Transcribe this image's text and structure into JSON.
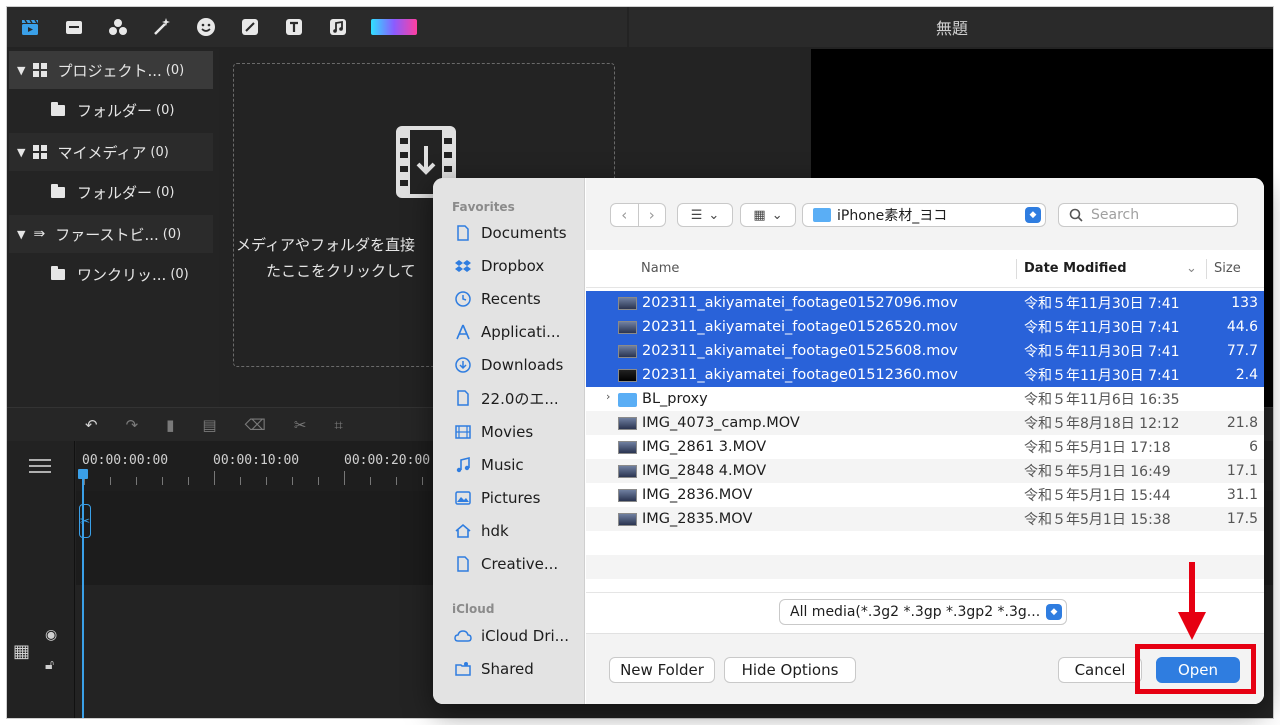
{
  "app": {
    "window_title": "無題",
    "toolbar_icons": [
      "clapper-icon",
      "media-icon",
      "effects-icon",
      "magic-icon",
      "sticker-icon",
      "transition-icon",
      "text-icon",
      "music-icon",
      "color-icon"
    ]
  },
  "library": {
    "items": [
      {
        "label": "プロジェクト...",
        "count": "(0)",
        "level": "parent",
        "icon": "grid-icon"
      },
      {
        "label": "フォルダー",
        "count": "(0)",
        "level": "sub",
        "icon": "folder-icon"
      },
      {
        "label": "マイメディア",
        "count": "(0)",
        "level": "parent",
        "icon": "grid-icon"
      },
      {
        "label": "フォルダー",
        "count": "(0)",
        "level": "sub",
        "icon": "folder-icon"
      },
      {
        "label": "ファーストビ...",
        "count": "(0)",
        "level": "parent",
        "icon": "arrow-icon"
      },
      {
        "label": "ワンクリッ...",
        "count": "(0)",
        "level": "sub",
        "icon": "folder-icon"
      }
    ]
  },
  "media": {
    "drop_line1": "メディアやフォルダを直接",
    "drop_line2": "たここをクリックして"
  },
  "timeline": {
    "timecodes": [
      "00:00:00:00",
      "00:00:10:00",
      "00:00:20:00"
    ]
  },
  "dialog": {
    "sidebar": {
      "favorites_label": "Favorites",
      "favorites": [
        {
          "label": "Documents",
          "icon": "document-icon"
        },
        {
          "label": "Dropbox",
          "icon": "dropbox-icon"
        },
        {
          "label": "Recents",
          "icon": "clock-icon"
        },
        {
          "label": "Applicati...",
          "icon": "applications-icon"
        },
        {
          "label": "Downloads",
          "icon": "download-icon"
        },
        {
          "label": "22.0のエ...",
          "icon": "document-icon"
        },
        {
          "label": "Movies",
          "icon": "film-icon"
        },
        {
          "label": "Music",
          "icon": "music-note-icon"
        },
        {
          "label": "Pictures",
          "icon": "picture-icon"
        },
        {
          "label": "hdk",
          "icon": "home-icon"
        },
        {
          "label": "Creative...",
          "icon": "document-icon"
        }
      ],
      "icloud_label": "iCloud",
      "icloud": [
        {
          "label": "iCloud Dri...",
          "icon": "cloud-icon"
        },
        {
          "label": "Shared",
          "icon": "shared-folder-icon"
        }
      ]
    },
    "toolbar": {
      "path": "iPhone素材_ヨコ",
      "search_placeholder": "Search"
    },
    "columns": {
      "name": "Name",
      "date": "Date Modified",
      "size": "Size"
    },
    "files": [
      {
        "name": "202311_akiyamatei_footage01527096.mov",
        "date": "令和５年11月30日 7:41",
        "size": "133",
        "selected": true,
        "type": "video"
      },
      {
        "name": "202311_akiyamatei_footage01526520.mov",
        "date": "令和５年11月30日 7:41",
        "size": "44.6",
        "selected": true,
        "type": "video"
      },
      {
        "name": "202311_akiyamatei_footage01525608.mov",
        "date": "令和５年11月30日 7:41",
        "size": "77.7",
        "selected": true,
        "type": "video"
      },
      {
        "name": "202311_akiyamatei_footage01512360.mov",
        "date": "令和５年11月30日 7:41",
        "size": "2.4",
        "selected": true,
        "type": "video"
      },
      {
        "name": "BL_proxy",
        "date": "令和５年11月6日 16:35",
        "size": "",
        "selected": false,
        "type": "folder"
      },
      {
        "name": "IMG_4073_camp.MOV",
        "date": "令和５年8月18日 12:12",
        "size": "21.8",
        "selected": false,
        "type": "video"
      },
      {
        "name": "IMG_2861 3.MOV",
        "date": "令和５年5月1日 17:18",
        "size": "6",
        "selected": false,
        "type": "video"
      },
      {
        "name": "IMG_2848 4.MOV",
        "date": "令和５年5月1日 16:49",
        "size": "17.1",
        "selected": false,
        "type": "video"
      },
      {
        "name": "IMG_2836.MOV",
        "date": "令和５年5月1日 15:44",
        "size": "31.1",
        "selected": false,
        "type": "video"
      },
      {
        "name": "IMG_2835.MOV",
        "date": "令和５年5月1日 15:38",
        "size": "17.5",
        "selected": false,
        "type": "video"
      }
    ],
    "filter": "All media(*.3g2 *.3gp *.3gp2 *.3g...",
    "buttons": {
      "new_folder": "New Folder",
      "hide_options": "Hide Options",
      "cancel": "Cancel",
      "open": "Open"
    }
  },
  "colors": {
    "selection": "#2962d9",
    "accent": "#2f7de0",
    "highlight": "#e60012"
  }
}
